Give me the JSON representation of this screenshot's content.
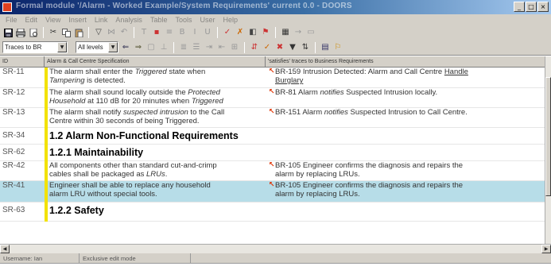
{
  "window": {
    "title": "Formal module '/Alarm - Worked Example/System Requirements' current 0.0 - DOORS",
    "buttons": {
      "minimize": "_",
      "maximize": "□",
      "close": "×"
    }
  },
  "menubar": [
    "File",
    "Edit",
    "View",
    "Insert",
    "Link",
    "Analysis",
    "Table",
    "Tools",
    "User",
    "Help"
  ],
  "toolbar2": {
    "view_combo": "Traces to BR",
    "level_combo": "All levels"
  },
  "columns": {
    "id": "ID",
    "spec": "Alarm & Call Centre Specification",
    "br": "'satisfies' traces to Business Requirements"
  },
  "rows": [
    {
      "id": "SR-11",
      "spec_a": "The alarm shall enter the ",
      "spec_i": "Triggered",
      "spec_b": " state when",
      "spec_c": "Tampering",
      "spec_d": " is detected.",
      "br_a": "BR-159  Intrusion Detected: Alarm and Call Centre ",
      "br_u": "Handle",
      "br_u2": "Burglary"
    },
    {
      "id": "SR-12",
      "spec_a": "The alarm shall sound locally outside the ",
      "spec_i": "Protected",
      "spec_c": "Household",
      "spec_d": " at 110 dB for 20 minutes when ",
      "spec_i2": "Triggered",
      "br_a": "BR-81  Alarm ",
      "br_i": "notifies",
      "br_b": " Suspected Intrusion locally."
    },
    {
      "id": "SR-13",
      "spec_a": "The alarm shall notify ",
      "spec_i": "suspected intrusion",
      "spec_b": " to the Call",
      "spec_c2": "Centre within 30 seconds of being Triggered.",
      "br_a": "BR-151  Alarm ",
      "br_i": "notifies",
      "br_b": " Suspected Intrusion to Call Centre."
    },
    {
      "id": "SR-34",
      "heading": "1.2 Alarm Non-Functional Requirements"
    },
    {
      "id": "SR-62",
      "heading": "1.2.1 Maintainability"
    },
    {
      "id": "SR-42",
      "spec_a": "All components other than standard cut-and-crimp",
      "spec_c2": "cables shall be packaged as ",
      "spec_i": "LRUs",
      "spec_d": ".",
      "br_a": "BR-105  Engineer confirms the diagnosis and repairs the",
      "br_c": "alarm by replacing LRUs."
    },
    {
      "id": "SR-41",
      "spec_a": "Engineer shall be able to replace any household",
      "spec_c2": "alarm LRU without special tools.",
      "br_a": "BR-105  Engineer confirms the diagnosis and repairs the",
      "br_c": "alarm by replacing LRUs."
    },
    {
      "id": "SR-63",
      "heading": "1.2.2 Safety"
    }
  ],
  "statusbar": {
    "user": "Username: Ian",
    "mode": "Exclusive edit mode"
  }
}
